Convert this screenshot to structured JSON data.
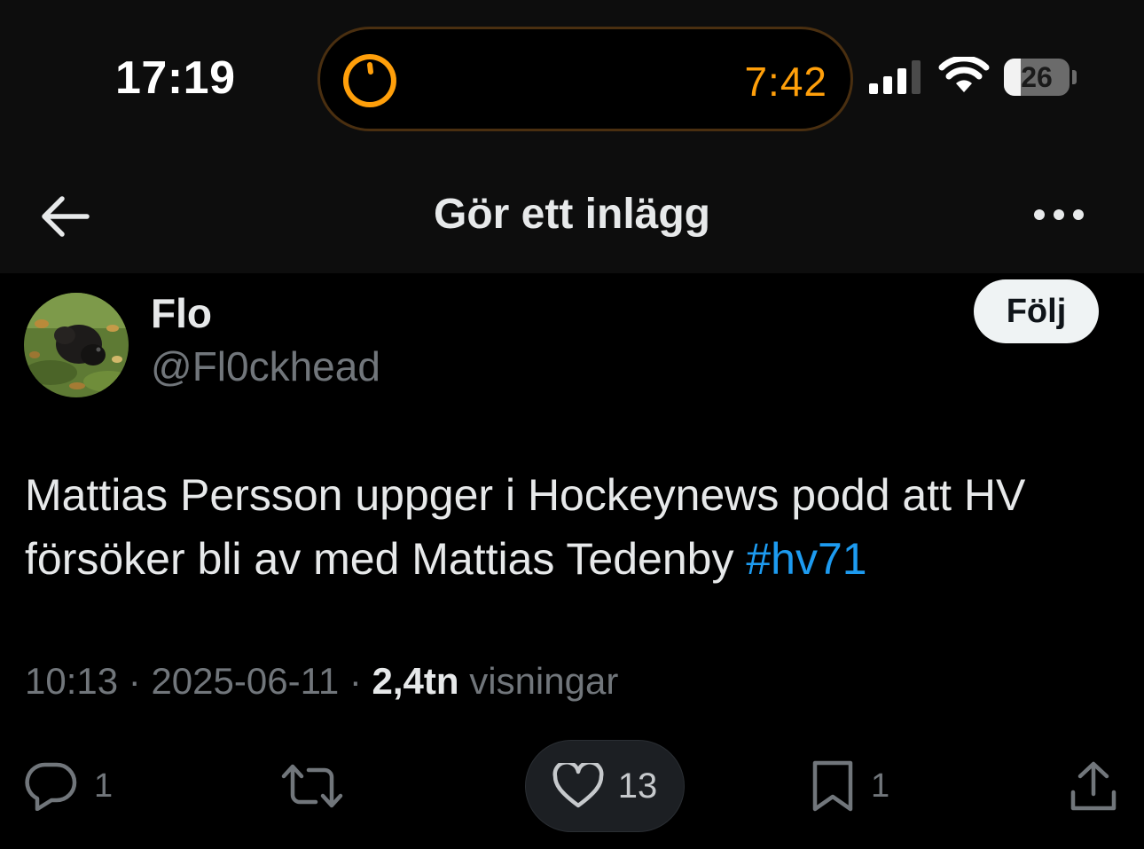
{
  "status_bar": {
    "time": "17:19",
    "timer": "7:42",
    "battery": "26",
    "battery_level": 0.26
  },
  "nav": {
    "title": "Gör ett inlägg"
  },
  "post": {
    "display_name": "Flo",
    "handle": "@Fl0ckhead",
    "follow_label": "Följ",
    "text": "Mattias Persson uppger i Hockeynews podd att HV försöker bli av med Mattias Tedenby",
    "hashtag": "#hv71",
    "time": "10:13",
    "separator": "·",
    "date": "2025-06-11",
    "views_count": "2,4tn",
    "views_label": "visningar"
  },
  "actions": {
    "replies": "1",
    "likes": "13",
    "bookmarks": "1"
  },
  "colors": {
    "accent": "#1d9bf0",
    "timer": "#ff9f0a",
    "muted": "#71767b"
  }
}
